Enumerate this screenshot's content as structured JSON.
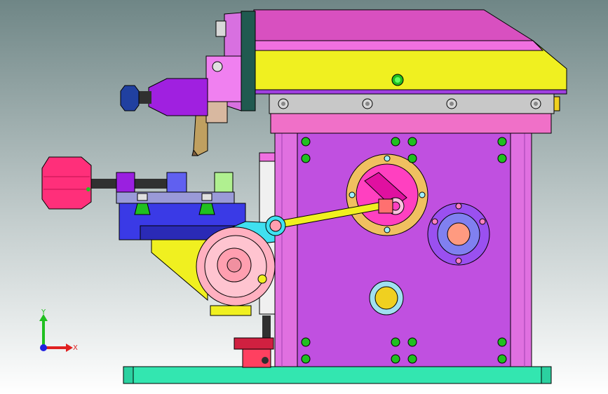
{
  "viewport": {
    "background_top": "#6f8686",
    "background_bottom": "#ffffff"
  },
  "colors": {
    "base_plate": "#33e6b0",
    "housing": "#c050e0",
    "column": "#e070e0",
    "top_head": "#f0f020",
    "top_cover": "#d850c0",
    "guide_rail": "#c8c8c8",
    "knob": "#ff2f7a",
    "tool_post": "#3a3ae6",
    "tool_post_top": "#9a9ad8",
    "gear": "#ffb0c0",
    "cam_ring": "#f0c060",
    "cam_face": "#ff40c0",
    "link": "#f0f020",
    "bolt": "#20c020",
    "spindle_nose": "#a020e0",
    "cyan_bracket": "#40e0f0",
    "yellow_bracket": "#f0f020",
    "hub_blue": "#8080f0"
  },
  "triad": {
    "y_label": "Y",
    "x_label": "X",
    "y_color": "#20c020",
    "x_color": "#e02020",
    "z_color": "#2020e0"
  }
}
